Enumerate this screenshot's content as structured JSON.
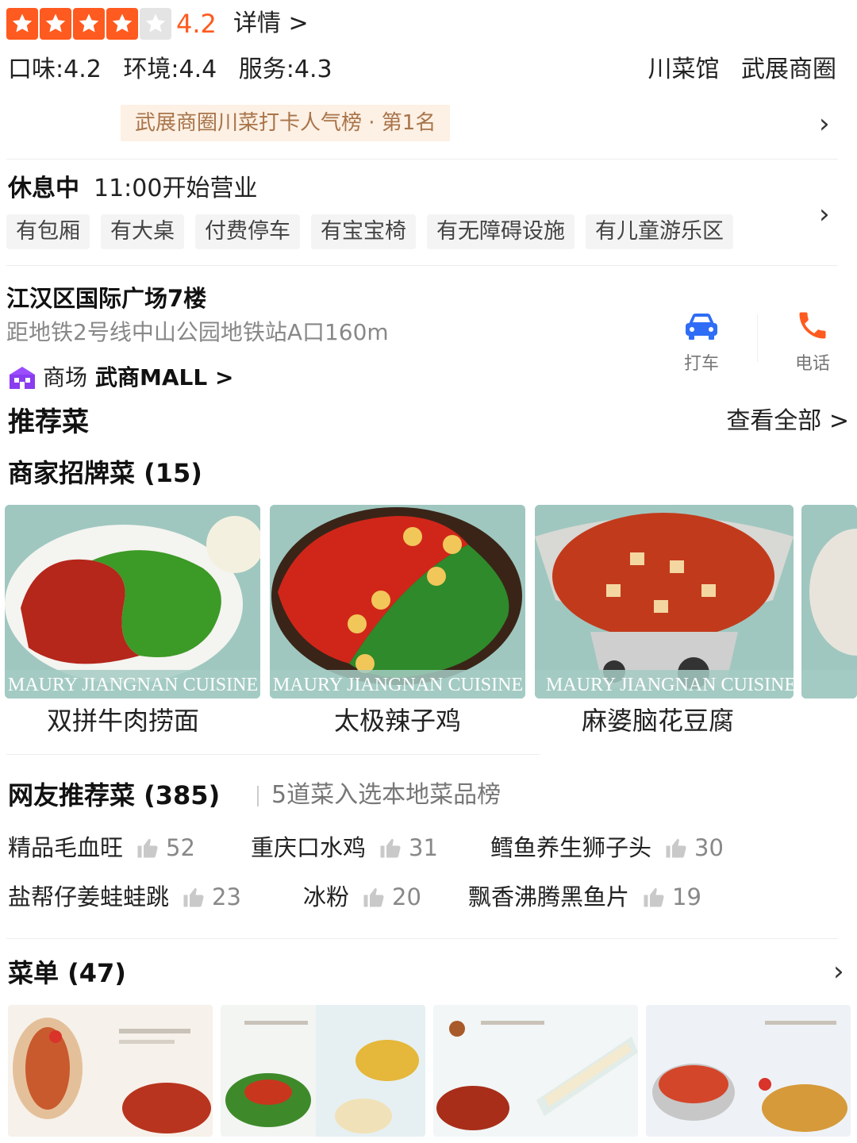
{
  "rating": {
    "value": "4.2",
    "stars_filled": 4,
    "stars_total": 5,
    "detail_label": "详情 >"
  },
  "sub_scores": [
    {
      "label": "口味:4.2"
    },
    {
      "label": "环境:4.4"
    },
    {
      "label": "服务:4.3"
    }
  ],
  "category": "川菜馆",
  "area": "武展商圈",
  "rank_badge": "武展商圈川菜打卡人气榜 · 第1名",
  "status": {
    "state": "休息中",
    "open_time": "11:00开始营业"
  },
  "facilities": [
    "有包厢",
    "有大桌",
    "付费停车",
    "有宝宝椅",
    "有无障碍设施",
    "有儿童游乐区"
  ],
  "address": "江汉区国际广场7楼",
  "metro": "距地铁2号线中山公园地铁站A口160m",
  "actions": {
    "taxi": "打车",
    "phone": "电话"
  },
  "mall": {
    "type": "商场",
    "name": "武商MALL >"
  },
  "recommended": {
    "title": "推荐菜",
    "see_all": "查看全部 >"
  },
  "signature": {
    "title": "商家招牌菜 (15)",
    "dishes": [
      {
        "name": "双拼牛肉捞面"
      },
      {
        "name": "太极辣子鸡"
      },
      {
        "name": "麻婆脑花豆腐"
      }
    ],
    "watermark": "MAURY JIANGNAN CUISINE"
  },
  "netfriend": {
    "title": "网友推荐菜 (385)",
    "subtitle": "5道菜入选本地菜品榜",
    "items": [
      {
        "name": "精品毛血旺",
        "count": "52"
      },
      {
        "name": "重庆口水鸡",
        "count": "31"
      },
      {
        "name": "鳕鱼养生狮子头",
        "count": "30"
      },
      {
        "name": "盐帮仔姜蛙蛙跳",
        "count": "23"
      },
      {
        "name": "冰粉",
        "count": "20"
      },
      {
        "name": "飘香沸腾黑鱼片",
        "count": "19"
      }
    ]
  },
  "menu": {
    "title": "菜单 (47)"
  },
  "colors": {
    "accent": "#ff5a1f",
    "badge_bg": "#fdf0e4",
    "badge_text": "#a8744a",
    "taxi_blue": "#2f6df6",
    "phone_orange": "#ff5a1f"
  }
}
